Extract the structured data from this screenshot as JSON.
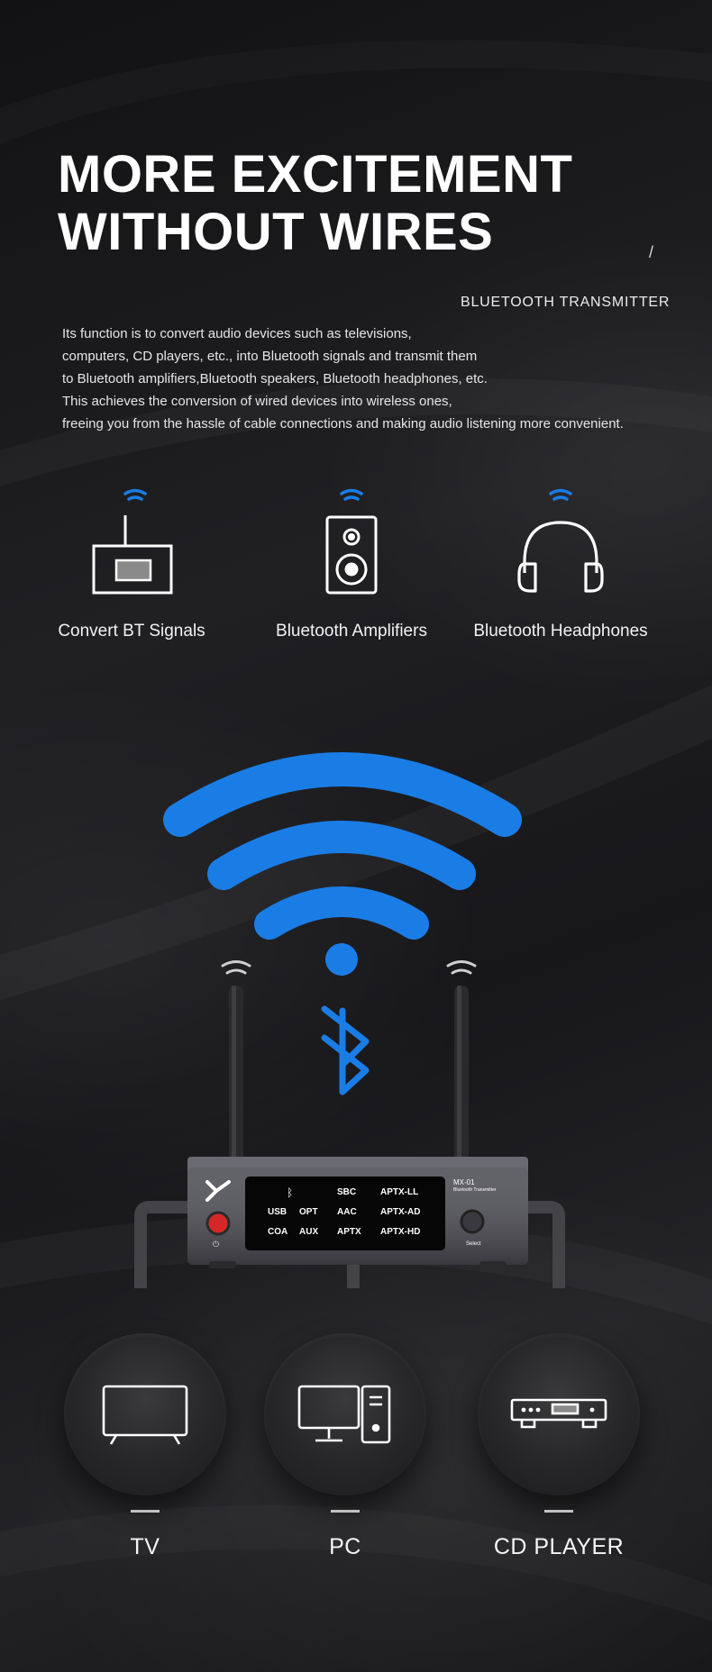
{
  "headline": {
    "line1": "MORE EXCITEMENT",
    "line2": "WITHOUT WIRES"
  },
  "slash": "/",
  "subtitle": "BLUETOOTH  TRANSMITTER",
  "intro": [
    "Its function is to convert audio devices such as televisions,",
    "computers, CD players, etc., into Bluetooth signals and transmit them",
    "to Bluetooth amplifiers,Bluetooth speakers, Bluetooth headphones, etc.",
    "This achieves the conversion of wired devices into wireless ones,",
    "freeing you from the hassle of cable connections and making audio listening more convenient."
  ],
  "targets": [
    {
      "label": "Convert BT Signals",
      "icon": "radio-receiver-icon"
    },
    {
      "label": "Bluetooth Amplifiers",
      "icon": "speaker-icon"
    },
    {
      "label": "Bluetooth Headphones",
      "icon": "headphones-icon"
    }
  ],
  "device": {
    "brand_mark": "X",
    "model": "MX-01",
    "model_sub": "Bluetooth Transmitter",
    "select_label": "Select",
    "display": {
      "row1": [
        "SBC",
        "APTX-LL"
      ],
      "row2": [
        "USB",
        "OPT",
        "AAC",
        "APTX-AD"
      ],
      "row3": [
        "COA",
        "AUX",
        "APTX",
        "APTX-HD"
      ]
    }
  },
  "sources": [
    {
      "label": "TV",
      "icon": "tv-icon"
    },
    {
      "label": "PC",
      "icon": "computer-icon"
    },
    {
      "label": "CD PLAYER",
      "icon": "cd-player-icon"
    }
  ],
  "colors": {
    "accent_blue": "#1a7de6",
    "power_red": "#d42828",
    "background": "#1c1c1e",
    "device_body": "#505058"
  }
}
